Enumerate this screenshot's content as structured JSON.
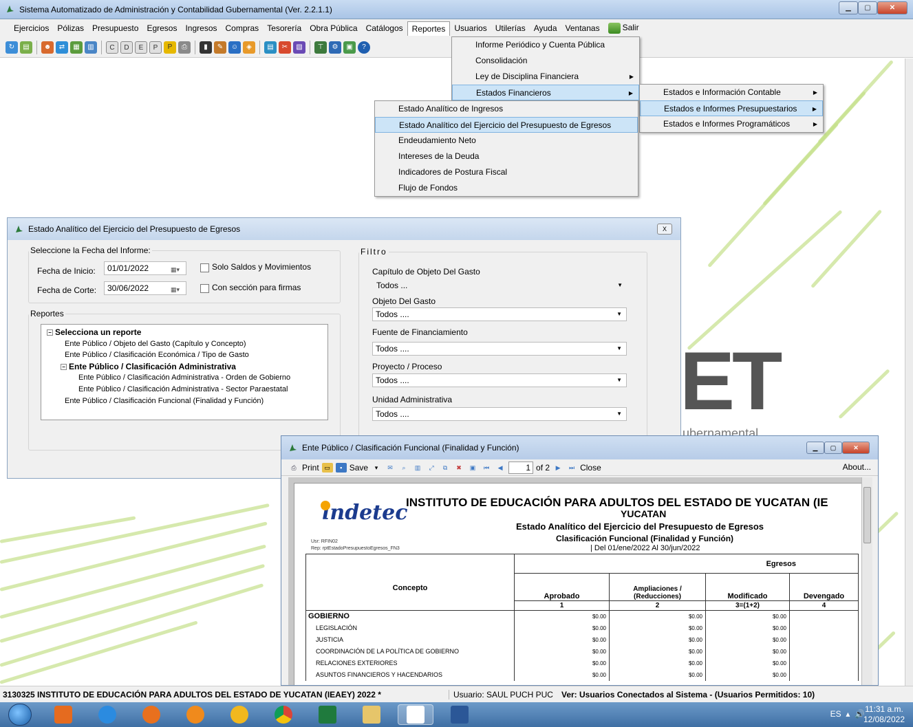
{
  "app": {
    "title": "Sistema Automatizado de Administración y Contabilidad Gubernamental  (Ver. 2.2.1.1)"
  },
  "menubar": {
    "items": [
      "Ejercicios",
      "Pólizas",
      "Presupuesto",
      "Egresos",
      "Ingresos",
      "Compras",
      "Tesorería",
      "Obra Pública",
      "Catálogos",
      "Reportes",
      "Usuarios",
      "Utilerías",
      "Ayuda",
      "Ventanas",
      "Salir"
    ],
    "active": "Reportes"
  },
  "reportes_menu": {
    "items": [
      {
        "label": "Informe Periódico y Cuenta Pública",
        "submenu": false
      },
      {
        "label": "Consolidación",
        "submenu": false
      },
      {
        "label": "Ley de Disciplina Financiera",
        "submenu": true
      },
      {
        "label": "Estados Financieros",
        "submenu": true
      }
    ],
    "highlighted": "Estados Financieros"
  },
  "estados_financieros_menu": {
    "items": [
      {
        "label": "Estados e Información Contable",
        "submenu": true
      },
      {
        "label": "Estados e Informes Presupuestarios",
        "submenu": true
      },
      {
        "label": "Estados e Informes Programáticos",
        "submenu": true
      }
    ],
    "highlighted": "Estados e Informes Presupuestarios"
  },
  "presupuestarios_menu": {
    "items": [
      "Estado Analítico de Ingresos",
      "Estado Analítico del Ejercicio del Presupuesto de Egresos",
      "Endeudamiento Neto",
      "Intereses de la Deuda",
      "Indicadores de Postura Fiscal",
      "Flujo de Fondos"
    ],
    "highlighted": "Estado Analítico del Ejercicio del Presupuesto de Egresos"
  },
  "dialog": {
    "title": "Estado Analítico del Ejercicio del Presupuesto de Egresos",
    "close_label": "X",
    "fecha_group": "Seleccione la Fecha del Informe:",
    "fecha_inicio_label": "Fecha de Inicio:",
    "fecha_inicio_value": "01/01/2022",
    "fecha_corte_label": "Fecha de Corte:",
    "fecha_corte_value": "30/06/2022",
    "solo_saldos_label": "Solo Saldos y Movimientos",
    "solo_saldos_checked": false,
    "firmas_label": "Con sección para firmas",
    "firmas_checked": false,
    "reportes_group": "Reportes",
    "tree": [
      {
        "label": "Selecciona un reporte",
        "level": 0,
        "bold": true,
        "toggle": "−"
      },
      {
        "label": "Ente Público / Objeto del Gasto (Capítulo y Concepto)",
        "level": 1,
        "bold": false
      },
      {
        "label": "Ente Público / Clasificación Económica / Tipo de Gasto",
        "level": 1,
        "bold": false
      },
      {
        "label": "Ente Público / Clasificación Administrativa",
        "level": 1,
        "bold": true,
        "toggle": "−"
      },
      {
        "label": "Ente Público / Clasificación Administrativa - Orden de Gobierno",
        "level": 2,
        "bold": false
      },
      {
        "label": "Ente Público / Clasificación Administrativa - Sector Paraestatal",
        "level": 2,
        "bold": false
      },
      {
        "label": "Ente Público / Clasificación Funcional (Finalidad y Función)",
        "level": 1,
        "bold": false
      }
    ],
    "filtro_group": "Filtro",
    "filters": [
      {
        "label": "Capítulo de Objeto Del Gasto",
        "value": "Todos  ..."
      },
      {
        "label": "Objeto Del Gasto",
        "value": "Todos ...."
      },
      {
        "label": "Fuente de Financiamiento",
        "value": "Todos ...."
      },
      {
        "label": "Proyecto / Proceso",
        "value": "Todos ...."
      },
      {
        "label": "Unidad Administrativa",
        "value": "Todos ...."
      }
    ]
  },
  "viewer": {
    "title": "Ente Público /  Clasificación Funcional (Finalidad y Función)",
    "toolbar": {
      "print": "Print",
      "save": "Save",
      "page_current": "1",
      "page_total": "of 2",
      "close": "Close",
      "about": "About..."
    },
    "report": {
      "logo": "indetec",
      "title_line1": "INSTITUTO DE EDUCACIÓN PARA ADULTOS DEL ESTADO DE YUCATAN (IE",
      "title_line2": "YUCATAN",
      "subtitle": "Estado Analítico del Ejercicio del Presupuesto de Egresos",
      "classification": "Clasificación Funcional (Finalidad y Función)",
      "period": "| Del 01/ene/2022 Al 30/jun/2022",
      "usr": "Usr: RFIN02",
      "rep": "Rep: rptEstadoPresupuestoEgresos_FN3",
      "group_header": "Egresos",
      "columns": [
        {
          "label": "Concepto",
          "num": ""
        },
        {
          "label": "Aprobado",
          "num": "1"
        },
        {
          "label": "Ampliaciones / (Reducciones)",
          "num": "2"
        },
        {
          "label": "Modificado",
          "num": "3=(1+2)"
        },
        {
          "label": "Devengado",
          "num": "4"
        }
      ],
      "rows": [
        {
          "concepto": "GOBIERNO",
          "bold": true,
          "aprobado": "$0.00",
          "ampliaciones": "$0.00",
          "modificado": "$0.00"
        },
        {
          "concepto": "LEGISLACIÓN",
          "bold": false,
          "aprobado": "$0.00",
          "ampliaciones": "$0.00",
          "modificado": "$0.00"
        },
        {
          "concepto": "JUSTICIA",
          "bold": false,
          "aprobado": "$0.00",
          "ampliaciones": "$0.00",
          "modificado": "$0.00"
        },
        {
          "concepto": "COORDINACIÓN DE LA POLÍTICA DE GOBIERNO",
          "bold": false,
          "aprobado": "$0.00",
          "ampliaciones": "$0.00",
          "modificado": "$0.00"
        },
        {
          "concepto": "RELACIONES EXTERIORES",
          "bold": false,
          "aprobado": "$0.00",
          "ampliaciones": "$0.00",
          "modificado": "$0.00"
        },
        {
          "concepto": "ASUNTOS FINANCIEROS Y HACENDARIOS",
          "bold": false,
          "aprobado": "$0.00",
          "ampliaciones": "$0.00",
          "modificado": "$0.00"
        }
      ]
    }
  },
  "background": {
    "logo_text": "ET",
    "logo_sub": "ubernamental"
  },
  "statusbar": {
    "entity": "3130325 INSTITUTO DE EDUCACIÓN PARA ADULTOS DEL ESTADO DE YUCATAN (IEAEY)  2022  *",
    "user": "Usuario: SAUL PUCH PUC",
    "connected": "Ver: Usuarios Conectados al Sistema - (Usuarios Permitidos: 10)"
  },
  "taskbar": {
    "language": "ES",
    "time": "11:31 a.m.",
    "date": "12/08/2022"
  },
  "colors": {
    "menu_highlight": "#cce4f7",
    "titlebar": "#b9d0ea",
    "taskbar": "#4f7fb5",
    "indetec_blue": "#1b3b8e"
  }
}
